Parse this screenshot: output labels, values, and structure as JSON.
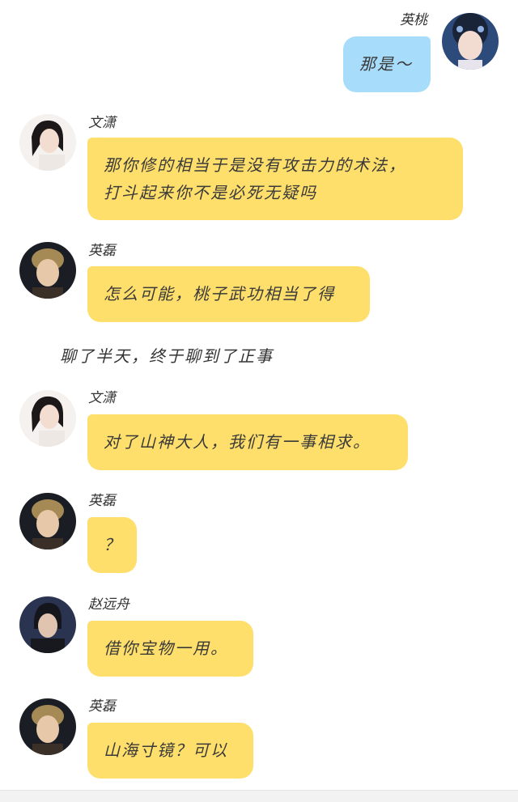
{
  "messages": [
    {
      "sender": "英桃",
      "text": "那是～"
    },
    {
      "sender": "文潇",
      "line1": "那你修的相当于是没有攻击力的术法，",
      "line2": "打斗起来你不是必死无疑吗"
    },
    {
      "sender": "英磊",
      "text": "怎么可能，桃子武功相当了得"
    },
    {
      "narration": "聊了半天，终于聊到了正事"
    },
    {
      "sender": "文潇",
      "text": "对了山神大人，我们有一事相求。"
    },
    {
      "sender": "英磊",
      "text": "？"
    },
    {
      "sender": "赵远舟",
      "text": "借你宝物一用。"
    },
    {
      "sender": "英磊",
      "text": "山海寸镜？可以"
    }
  ],
  "colors": {
    "yellow_bubble": "#ffdf6b",
    "blue_bubble": "#a8dcfb"
  }
}
